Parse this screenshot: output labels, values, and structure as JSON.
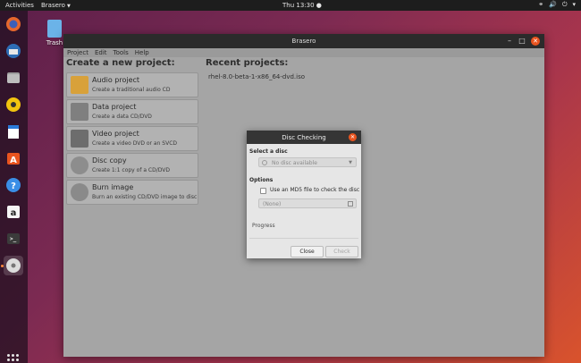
{
  "topbar": {
    "activities": "Activities",
    "app_menu": "Brasero",
    "clock": "Thu 13:30"
  },
  "desktop": {
    "trash_label": "Trash"
  },
  "window": {
    "title": "Brasero",
    "menu": [
      "Project",
      "Edit",
      "Tools",
      "Help"
    ],
    "create_title": "Create a new project:",
    "recent_title": "Recent projects:",
    "projects": [
      {
        "name": "Audio project",
        "desc": "Create a traditional audio CD",
        "icon": "audio-icon",
        "color": "#d8a13a"
      },
      {
        "name": "Data project",
        "desc": "Create a data CD/DVD",
        "icon": "data-icon",
        "color": "#7f7f7f"
      },
      {
        "name": "Video project",
        "desc": "Create a video DVD or an SVCD",
        "icon": "video-icon",
        "color": "#6d6d6d"
      },
      {
        "name": "Disc copy",
        "desc": "Create 1:1 copy of a CD/DVD",
        "icon": "disc-copy-icon",
        "color": "#8d8d8d"
      },
      {
        "name": "Burn image",
        "desc": "Burn an existing CD/DVD image to disc",
        "icon": "burn-image-icon",
        "color": "#8a8a8a"
      }
    ],
    "recent_items": [
      "rhel-8.0-beta-1-x86_64-dvd.iso"
    ]
  },
  "dialog": {
    "title": "Disc Checking",
    "select_label": "Select a disc",
    "select_value": "No disc available",
    "options_label": "Options",
    "md5_label": "Use an MD5 file to check the disc",
    "file_value": "(None)",
    "progress_label": "Progress",
    "close_label": "Close",
    "check_label": "Check"
  },
  "colors": {
    "accent": "#e9541f",
    "window_bg": "#a5a5a5",
    "dialog_bg": "#e6e6e6"
  }
}
